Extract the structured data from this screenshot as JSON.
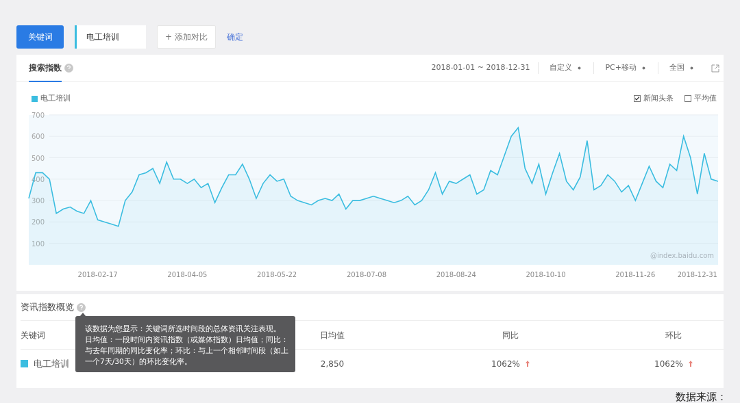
{
  "toolbar": {
    "keyword_button": "关键词",
    "keyword_field": {
      "value": "电工培训"
    },
    "add_compare": "+ 添加对比",
    "confirm": "确定"
  },
  "search_index": {
    "tabs": [
      {
        "label": "搜索指数",
        "selected": true
      }
    ],
    "date_range": "2018-01-01 ~ 2018-12-31",
    "filters": [
      "自定义",
      "PC+移动",
      "全国"
    ],
    "options": [
      {
        "label": "新闻头条",
        "checked": true
      },
      {
        "label": "平均值",
        "checked": false
      }
    ],
    "chart_data": {
      "type": "area",
      "grid": true,
      "ylim": [
        0,
        700
      ],
      "yticks": [
        100,
        200,
        300,
        400,
        500,
        600,
        700
      ],
      "categories": [
        null,
        null,
        null,
        null,
        null,
        null,
        null,
        null,
        null,
        null,
        "2018-02-17",
        null,
        null,
        null,
        null,
        null,
        null,
        null,
        null,
        null,
        null,
        null,
        null,
        "2018-04-05",
        null,
        null,
        null,
        null,
        null,
        null,
        null,
        null,
        null,
        null,
        null,
        null,
        "2018-05-22",
        null,
        null,
        null,
        null,
        null,
        null,
        null,
        null,
        null,
        null,
        null,
        null,
        "2018-07-08",
        null,
        null,
        null,
        null,
        null,
        null,
        null,
        null,
        null,
        null,
        null,
        null,
        "2018-08-24",
        null,
        null,
        null,
        null,
        null,
        null,
        null,
        null,
        null,
        null,
        null,
        null,
        "2018-10-10",
        null,
        null,
        null,
        null,
        null,
        null,
        null,
        null,
        null,
        null,
        null,
        null,
        "2018-11-26",
        null,
        null,
        null,
        null,
        null,
        null,
        null,
        null,
        "2018-12-31",
        null,
        null,
        null
      ],
      "series": [
        {
          "name": "电工培训",
          "color": "#3bbde0",
          "values": [
            310,
            430,
            430,
            400,
            240,
            260,
            270,
            250,
            240,
            300,
            210,
            200,
            190,
            180,
            300,
            340,
            420,
            430,
            450,
            380,
            480,
            400,
            400,
            380,
            400,
            360,
            380,
            290,
            360,
            420,
            420,
            470,
            400,
            310,
            380,
            420,
            390,
            400,
            320,
            300,
            290,
            280,
            300,
            310,
            300,
            330,
            260,
            300,
            300,
            310,
            320,
            310,
            300,
            290,
            300,
            320,
            280,
            300,
            350,
            430,
            330,
            390,
            380,
            400,
            420,
            330,
            350,
            440,
            420,
            510,
            600,
            640,
            450,
            380,
            470,
            330,
            430,
            520,
            390,
            350,
            410,
            580,
            350,
            370,
            420,
            390,
            340,
            370,
            300,
            380,
            460,
            390,
            360,
            470,
            440,
            600,
            500,
            330,
            520,
            400,
            390
          ]
        }
      ]
    },
    "credit": "@index.baidu.com"
  },
  "overview": {
    "title": "资讯指数概览",
    "columns": [
      "关键词",
      "日均值",
      "同比",
      "环比"
    ],
    "rows": [
      {
        "keyword": "电工培训",
        "color": "#3bbde0",
        "daily_avg": "2,850",
        "yoy": {
          "text": "1062%",
          "rising": true
        },
        "mom": {
          "text": "1062%",
          "rising": true
        }
      }
    ],
    "tooltip": [
      "该数据为您显示：关键词所选时间段的总体资讯关注表现。",
      "日均值：一段时间内资讯指数（或媒体指数）日均值；同比：与去年同期的同比变化率；环比：与上一个相邻时间段（如上一个7天/30天）的环比变化率。"
    ]
  },
  "source_note": "数据来源："
}
